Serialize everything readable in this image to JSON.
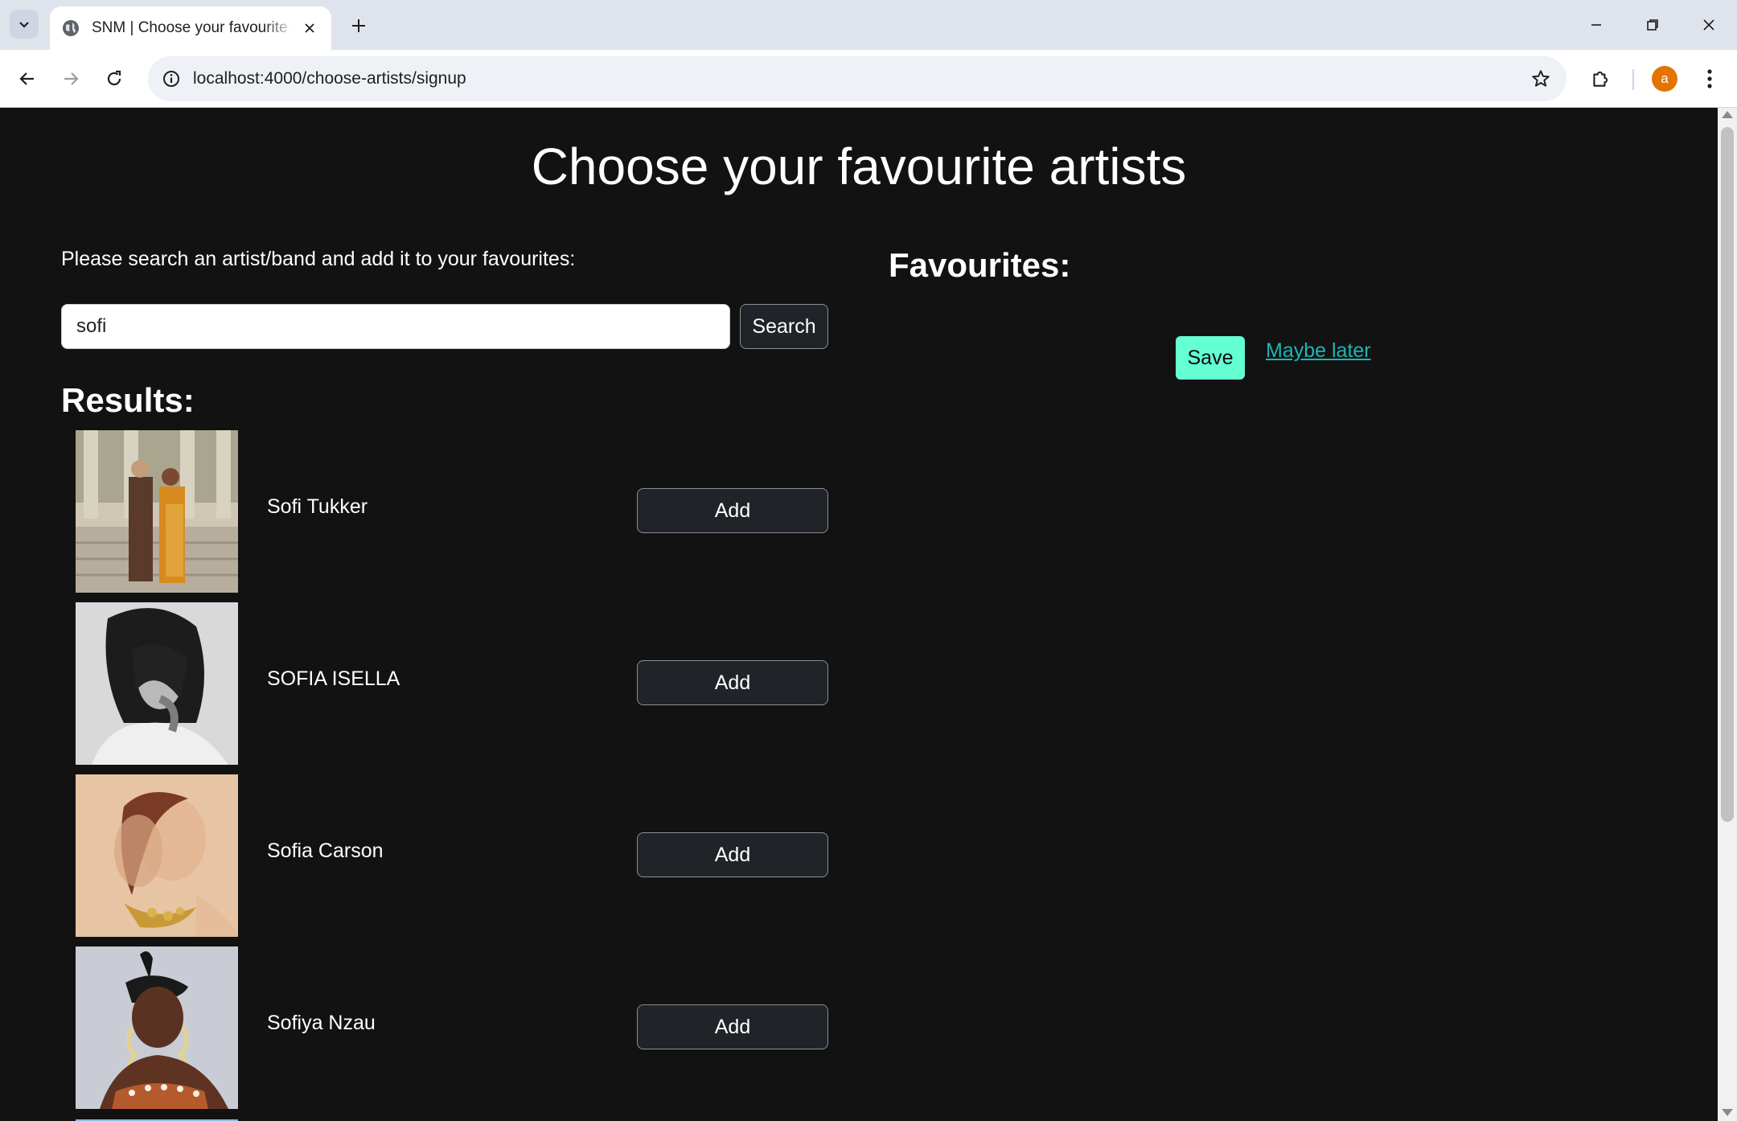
{
  "browser": {
    "tab_title": "SNM | Choose your favourite artists",
    "url": "localhost:4000/choose-artists/signup",
    "profile_initial": "a"
  },
  "page": {
    "title": "Choose your favourite artists",
    "instruction": "Please search an artist/band and add it to your favourites:",
    "search": {
      "value": "sofi",
      "button_label": "Search"
    },
    "results_heading": "Results:",
    "results": [
      {
        "name": "Sofi Tukker",
        "add_label": "Add"
      },
      {
        "name": "SOFIA ISELLA",
        "add_label": "Add"
      },
      {
        "name": "Sofia Carson",
        "add_label": "Add"
      },
      {
        "name": "Sofiya Nzau",
        "add_label": "Add"
      }
    ],
    "favourites_heading": "Favourites:",
    "save_label": "Save",
    "maybe_later_label": "Maybe later"
  },
  "colors": {
    "page_background": "#121212",
    "accent_save": "#64ffd2",
    "link": "#1fb4b4"
  }
}
